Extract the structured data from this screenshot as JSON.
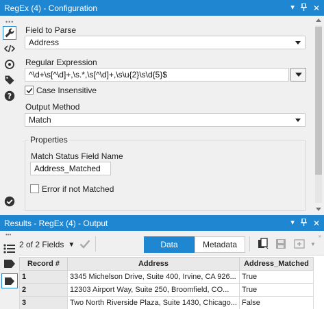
{
  "config_window": {
    "title": "RegEx (4) - Configuration",
    "controls": [
      "dropdown-arrow-icon",
      "pin-icon",
      "close-icon"
    ]
  },
  "sidebar": {
    "icons": [
      "wrench-icon",
      "code-icon",
      "target-icon",
      "tag-icon",
      "help-icon",
      "checkmark-circle-icon"
    ]
  },
  "field_to_parse": {
    "label": "Field to Parse",
    "value": "Address"
  },
  "regex": {
    "label": "Regular Expression",
    "value": "^\\d+\\s[^\\d]+,\\s.*,\\s[^\\d]+,\\s\\u{2}\\s\\d{5}$"
  },
  "case_insensitive": {
    "label": "Case Insensitive",
    "checked": true
  },
  "output_method": {
    "label": "Output Method",
    "value": "Match"
  },
  "properties": {
    "title": "Properties",
    "match_status_label": "Match Status Field Name",
    "match_status_value": "Address_Matched",
    "error_label": "Error if not Matched",
    "error_checked": false
  },
  "results_window": {
    "title": "Results - RegEx (4) - Output",
    "fields_selector": "2 of 2 Fields",
    "data_tab": "Data",
    "metadata_tab": "Metadata"
  },
  "table": {
    "columns": [
      "Record #",
      "Address",
      "Address_Matched"
    ],
    "rows": [
      {
        "num": "1",
        "address": "3345 Michelson Drive, Suite 400, Irvine, CA 926...",
        "matched": "True"
      },
      {
        "num": "2",
        "address": "12303 Airport Way, Suite 250, Broomfield, CO...",
        "matched": "True"
      },
      {
        "num": "3",
        "address": "Two North Riverside Plaza, Suite 1430, Chicago...",
        "matched": "False"
      }
    ]
  },
  "colors": {
    "accent": "#1f86d2",
    "background": "#f0f0f0"
  }
}
